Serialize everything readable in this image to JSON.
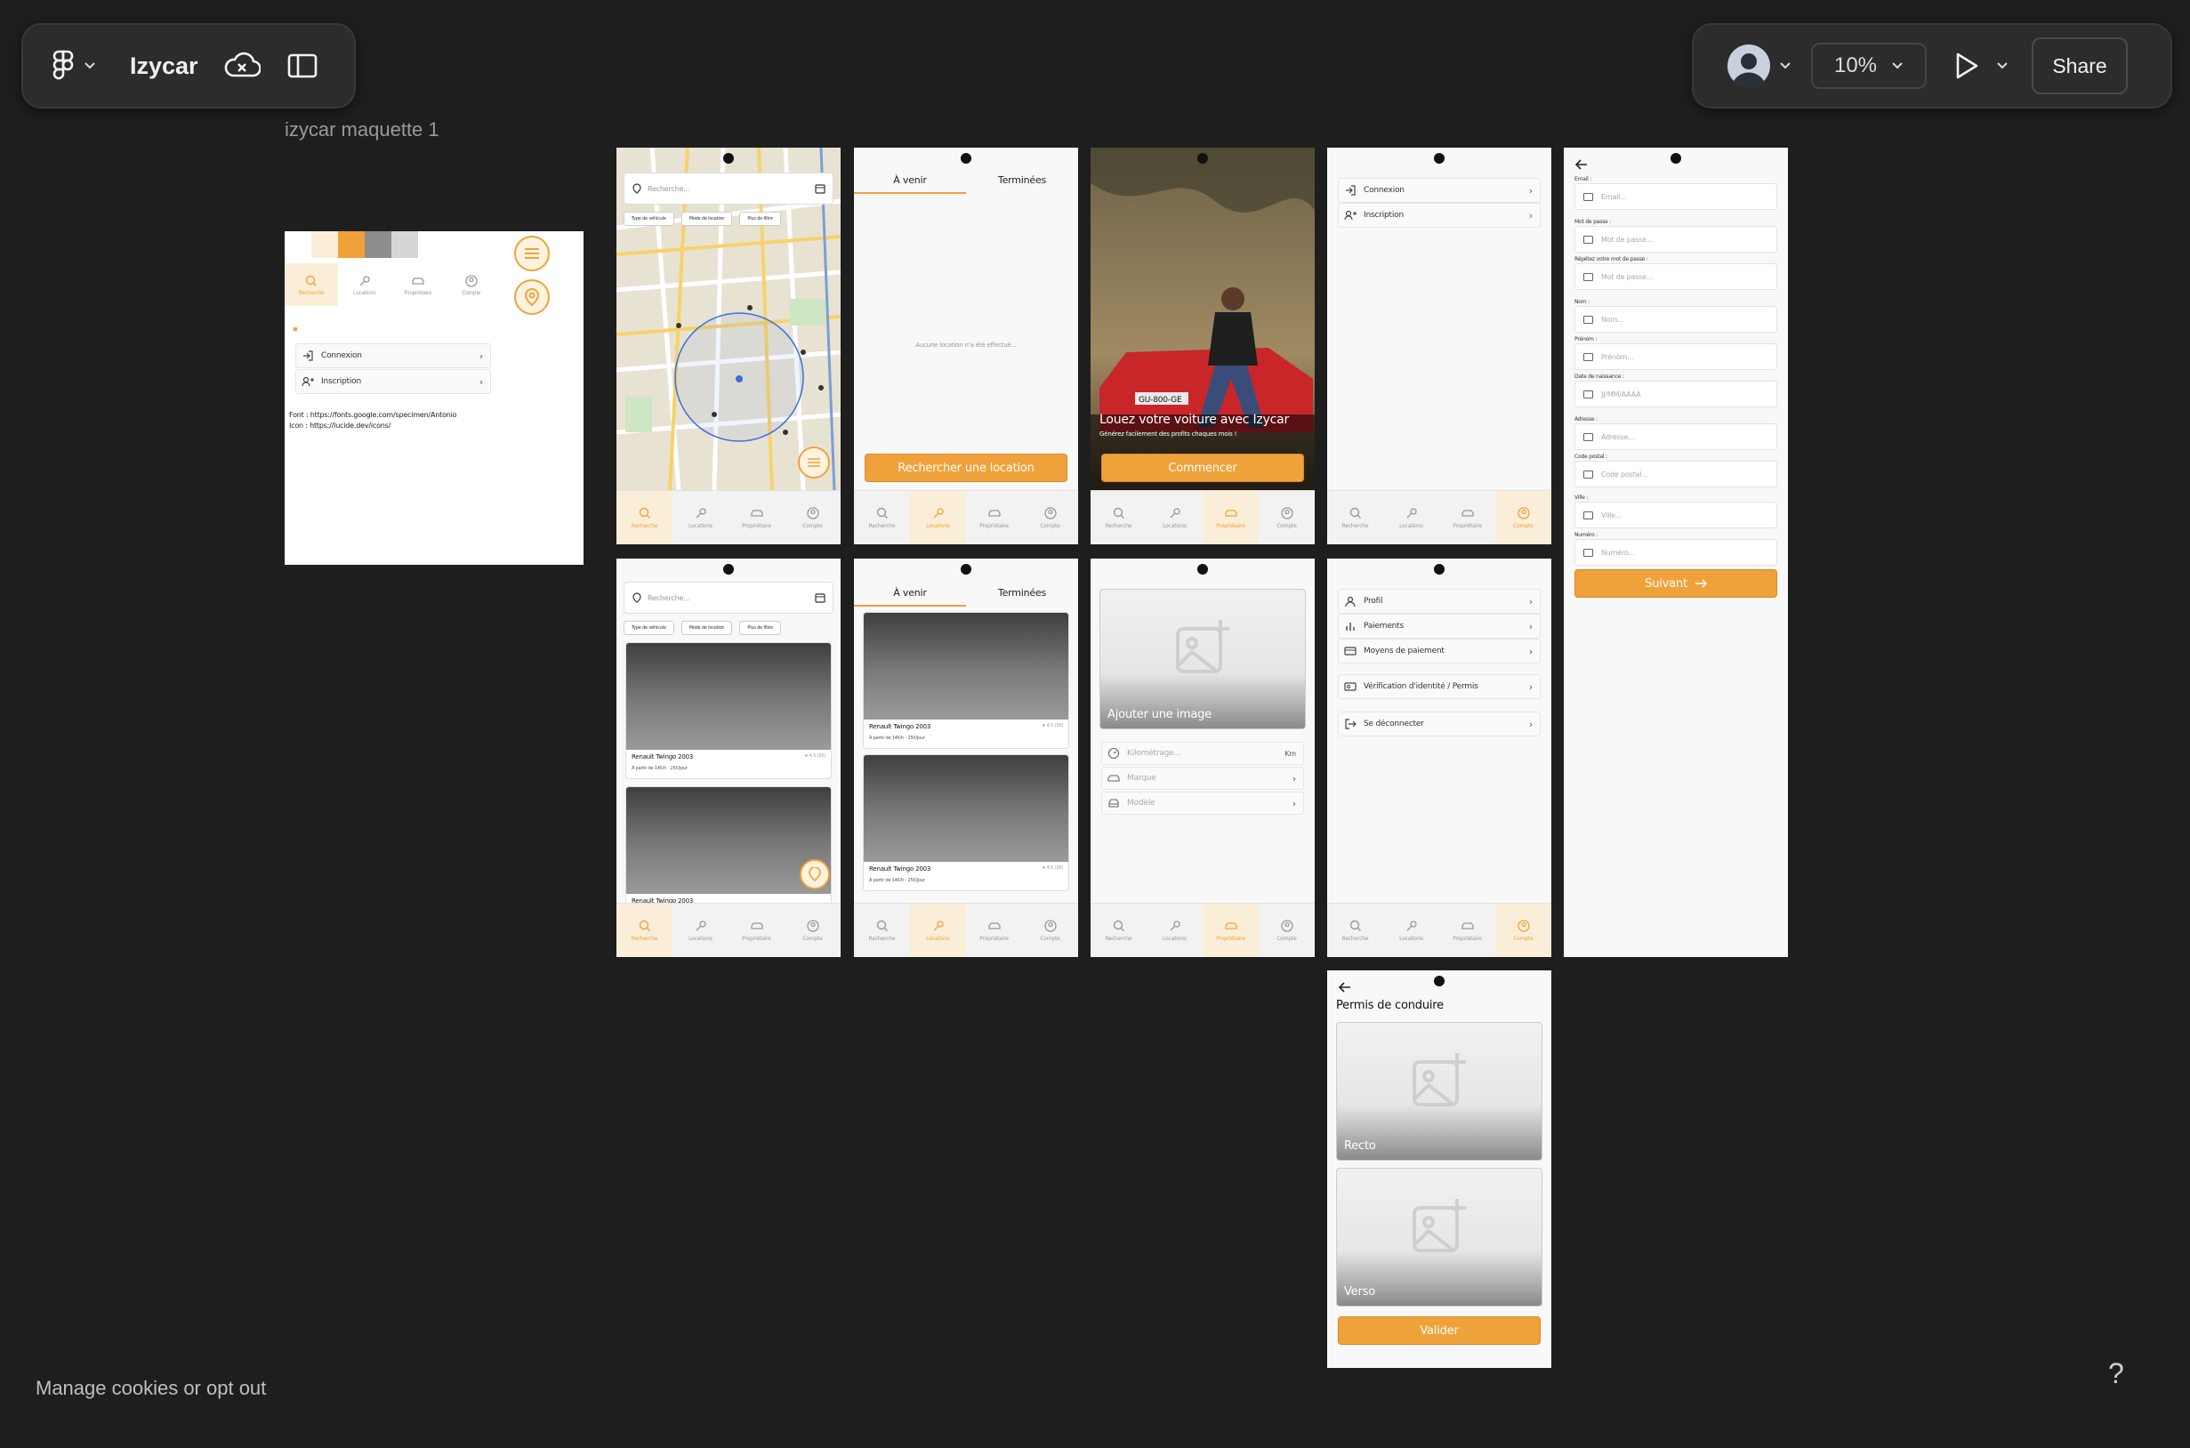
{
  "toolbar": {
    "file_name": "Izycar",
    "zoom": "10%",
    "share_label": "Share"
  },
  "canvas": {
    "frame_title": "izycar maquette 1",
    "cookies_link": "Manage cookies or opt out",
    "help_label": "?"
  },
  "nav_labels": [
    "Recherche",
    "Locations",
    "Propriétaire",
    "Compte"
  ],
  "style_guide": {
    "colors": [
      "#ffffff",
      "#fbeed9",
      "#f0a23a",
      "#8d8d8d",
      "#d6d6d6"
    ],
    "rows": [
      "Connexion",
      "Inscription"
    ],
    "font_note": "Font : https://fonts.google.com/specimen/Antonio",
    "icon_note": "Icon : https://lucide.dev/icons/"
  },
  "search": {
    "placeholder": "Recherche...",
    "chips": [
      "Type de véhicule",
      "Mode de location",
      "Plus de filtre"
    ]
  },
  "locations": {
    "tab_upcoming": "À venir",
    "tab_done": "Terminées",
    "empty": "Aucune location n'a été effectué...",
    "search_button": "Rechercher une location"
  },
  "onboarding": {
    "plate": "GU-800-GE",
    "title": "Louez votre voiture avec Izycar",
    "subtitle": "Générez facilement des profits chaques mois !",
    "start_button": "Commencer"
  },
  "account_guest": [
    "Connexion",
    "Inscription"
  ],
  "signup": {
    "fields": [
      {
        "label": "Email :",
        "placeholder": "Email..."
      },
      {
        "label": "Mot de passe :",
        "placeholder": "Mot de passe..."
      },
      {
        "label": "Répétez votre mot de passe :",
        "placeholder": "Mot de passe..."
      },
      {
        "label": "Nom :",
        "placeholder": "Nom..."
      },
      {
        "label": "Prénom :",
        "placeholder": "Prénom..."
      },
      {
        "label": "Date de naissance :",
        "placeholder": "JJ/MM/AAAA"
      },
      {
        "label": "Adresse :",
        "placeholder": "Adresse..."
      },
      {
        "label": "Code postal :",
        "placeholder": "Code postal..."
      },
      {
        "label": "Ville :",
        "placeholder": "Ville..."
      },
      {
        "label": "Numéro :",
        "placeholder": "Numéro..."
      }
    ],
    "next_button": "Suivant"
  },
  "car": {
    "name": "Renault Twingo 2003",
    "price": "À partir de 14€/h - 25€/jour",
    "rating": "★ 4.5 (35)"
  },
  "add_vehicle": {
    "add_image": "Ajouter une image",
    "mileage_placeholder": "Kilométrage...",
    "mileage_unit": "Km",
    "brand": "Marque",
    "model": "Modèle"
  },
  "account_menu": [
    "Profil",
    "Paiements",
    "Moyens de paiement",
    "Vérification d'identité / Permis",
    "Se déconnecter"
  ],
  "license": {
    "title": "Permis de conduire",
    "front": "Recto",
    "back": "Verso",
    "validate": "Valider"
  }
}
